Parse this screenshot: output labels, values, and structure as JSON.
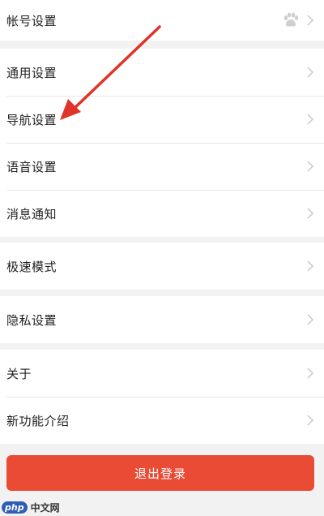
{
  "groups": [
    {
      "items": [
        {
          "label": "帐号设置",
          "has_avatar": true
        }
      ]
    },
    {
      "items": [
        {
          "label": "通用设置"
        },
        {
          "label": "导航设置"
        },
        {
          "label": "语音设置"
        },
        {
          "label": "消息通知"
        }
      ]
    },
    {
      "items": [
        {
          "label": "极速模式"
        }
      ]
    },
    {
      "items": [
        {
          "label": "隐私设置"
        }
      ]
    },
    {
      "items": [
        {
          "label": "关于"
        },
        {
          "label": "新功能介绍"
        }
      ]
    }
  ],
  "logout_button": {
    "label": "退出登录"
  },
  "watermark": {
    "logo": "php",
    "text": "中文网"
  },
  "colors": {
    "accent_red": "#e94b35",
    "background": "#f2f2f2",
    "arrow": "#e0332a"
  },
  "icons": {
    "chevron": "chevron-right-icon",
    "avatar": "baidu-paw-icon"
  }
}
